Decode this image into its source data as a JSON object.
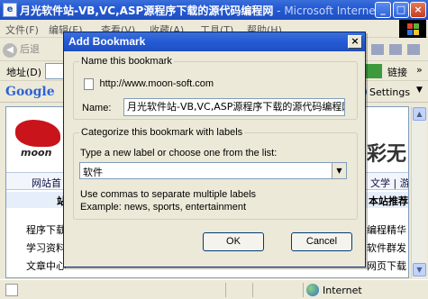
{
  "browser": {
    "title_main": "月光软件站-VB,VC,ASP源程序下载的源代码编程网",
    "title_suffix": " - Microsoft Internet E",
    "menu": [
      "文件(F)",
      "编辑(E)",
      "查看(V)",
      "收藏(A)",
      "工具(T)",
      "帮助(H)"
    ],
    "back_label": "后退",
    "address_label": "地址(D)",
    "links_label": "链接",
    "chevron": "»",
    "google_label": "Google",
    "settings_label": "Settings",
    "status_zone": "Internet",
    "window_buttons": {
      "minimize": "_",
      "maximize": "□",
      "close": "×"
    }
  },
  "page": {
    "logo_text": "moon",
    "banner_text": "彩无",
    "nav_left": "网站首",
    "nav_right": "文学 | 游戏",
    "sub_left": "站",
    "sub_right": "本站推荐",
    "rows_left": [
      "程序下载",
      "学习资料",
      "文章中心"
    ],
    "rows_right": [
      "编程精华",
      "软件群发",
      "网页下载"
    ]
  },
  "dialog": {
    "title": "Add Bookmark",
    "close": "×",
    "name_group_legend": "Name this bookmark",
    "url": "http://www.moon-soft.com",
    "name_label": "Name:",
    "name_value": "月光软件站-VB,VC,ASP源程序下载的源代码编程网",
    "label_group_legend": "Categorize this bookmark with labels",
    "label_hint": "Type a new label or choose one from the list:",
    "label_value": "软件",
    "help_1": "Use commas to separate multiple labels",
    "help_2": "Example: news, sports, entertainment",
    "ok_label": "OK",
    "cancel_label": "Cancel"
  }
}
